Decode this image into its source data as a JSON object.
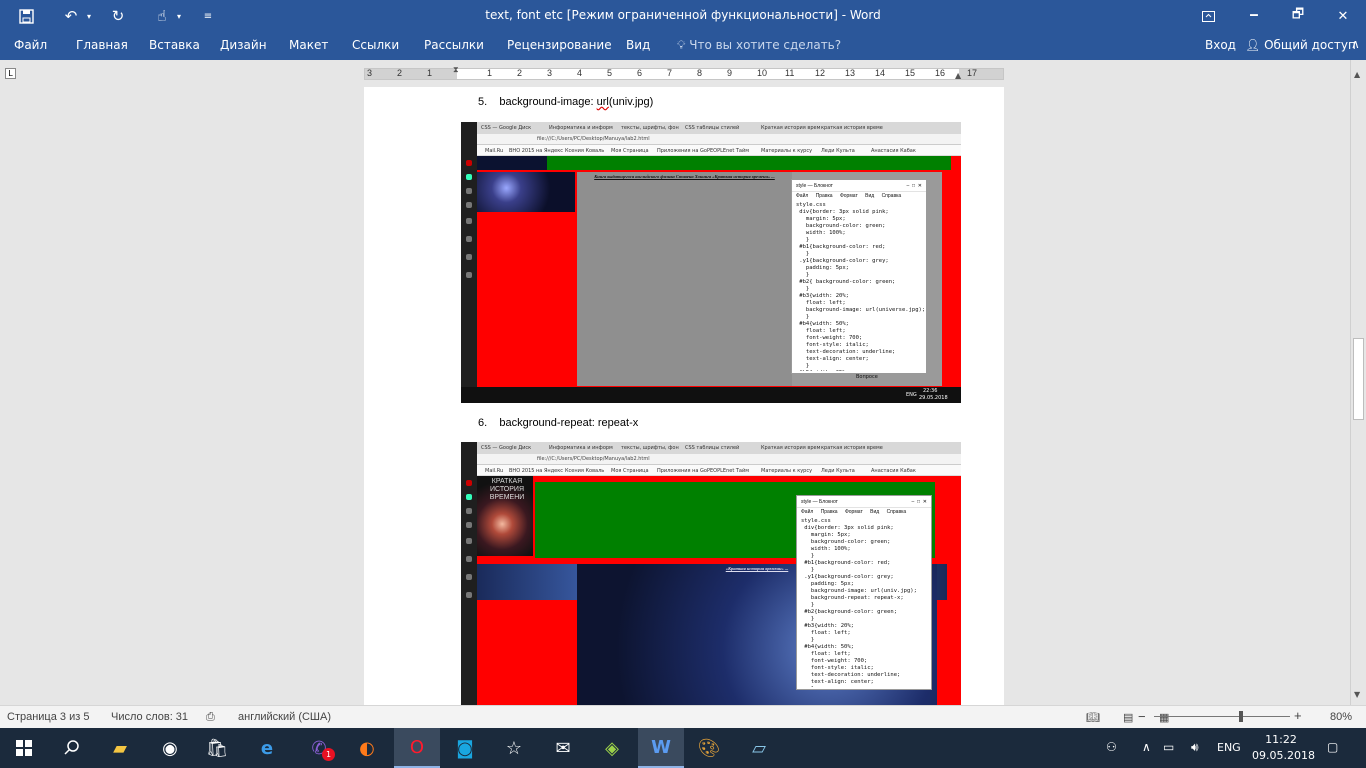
{
  "window": {
    "title": "text, font etc [Режим ограниченной функциональности] - Word",
    "save_icon": "save-icon",
    "undo_icon": "undo-icon",
    "redo_icon": "redo-icon",
    "touch_icon": "touch-mode-icon",
    "customize_icon": "customize-quick-access-icon",
    "restore_ribbon_icon": "ribbon-display-options-icon",
    "minimize": "🗕",
    "maximize": "🗗",
    "close": "✕"
  },
  "ribbon": {
    "tabs": [
      "Файл",
      "Главная",
      "Вставка",
      "Дизайн",
      "Макет",
      "Ссылки",
      "Рассылки",
      "Рецензирование",
      "Вид"
    ],
    "search_placeholder": "Что вы хотите сделать?",
    "signin": "Вход",
    "share": "Общий доступ"
  },
  "ruler": {
    "numbers": [
      "3",
      "2",
      "1",
      "1",
      "2",
      "3",
      "4",
      "5",
      "6",
      "7",
      "8",
      "9",
      "10",
      "11",
      "12",
      "13",
      "14",
      "15",
      "16",
      "17"
    ]
  },
  "document": {
    "item5_num": "5.",
    "item5_prefix": "background-image: ",
    "item5_squiggle": "url",
    "item5_suffix": "(univ.jpg)",
    "item6_num": "6.",
    "item6_text": "background-repeat: repeat-x"
  },
  "screenshot1": {
    "tabs": [
      "CSS — Google Диск",
      "Информатика и информ",
      "тексты, шрифты, фон",
      "CSS таблицы стилей",
      "Краткая история врем",
      "краткая история време"
    ],
    "address": "file:///C:/Users/PC/Desktop/Manuya/lab2.html",
    "bookmarks": [
      "Mail.Ru",
      "ВНО 2015 на Яндекс",
      "Ксения Коваль",
      "Моя Страница",
      "Приложения на Go",
      "PEOPLEnet Тайм",
      "Материалы к курсу",
      "Леди Культа",
      "Анастасия Кабак"
    ],
    "notepad_title": "style — Блокнот",
    "notepad_menu": [
      "Файл",
      "Правка",
      "Формат",
      "Вид",
      "Справка"
    ],
    "notepad_code": "style.css\n div{border: 3px solid pink;\n   margin: 5px;\n   background-color: green;\n   width: 100%;\n   }\n #b1{background-color: red;\n   }\n .y1{background-color: grey;\n   padding: 5px;\n   }\n #b2{ background-color: green;\n   }\n #b3{width: 20%;\n   float: left;\n   background-image: url(universe.jpg);\n   }\n #b4{width: 50%;\n   float: left;\n   font-weight: 700;\n   font-style: italic;\n   text-decoration: underline;\n   text-align: center;\n   }\n #b5{width: 25%;",
    "taskbar_lang": "ENG",
    "taskbar_time": "22:36",
    "taskbar_date": "29.05.2018",
    "footer_word": "Вопросе"
  },
  "screenshot2": {
    "notepad_title": "style — Блокнот",
    "notepad_menu": [
      "Файл",
      "Правка",
      "Формат",
      "Вид",
      "Справка"
    ],
    "notepad_code": "style.css\n div{border: 3px solid pink;\n   margin: 5px;\n   background-color: green;\n   width: 100%;\n   }\n #b1{background-color: red;\n   }\n .y1{background-color: grey;\n   padding: 5px;\n   background-image: url(univ.jpg);\n   background-repeat: repeat-x;\n   }\n #b2{background-color: green;\n   }\n #b3{width: 20%;\n   float: left;\n   }\n #b4{width: 50%;\n   float: left;\n   font-weight: 700;\n   font-style: italic;\n   text-decoration: underline;\n   text-align: center;\n   }",
    "book_title": "КРАТКАЯ ИСТОРИЯ ВРЕМЕНИ"
  },
  "statusbar": {
    "page": "Страница 3 из 5",
    "words": "Число слов: 31",
    "language": "английский (США)",
    "zoom": "80%"
  },
  "taskbar": {
    "lang": "ENG",
    "time": "11:22",
    "date": "09.05.2018",
    "viber_badge": "1"
  },
  "colors": {
    "word_blue": "#2b579a",
    "green": "#008000",
    "red": "#ff0000"
  }
}
